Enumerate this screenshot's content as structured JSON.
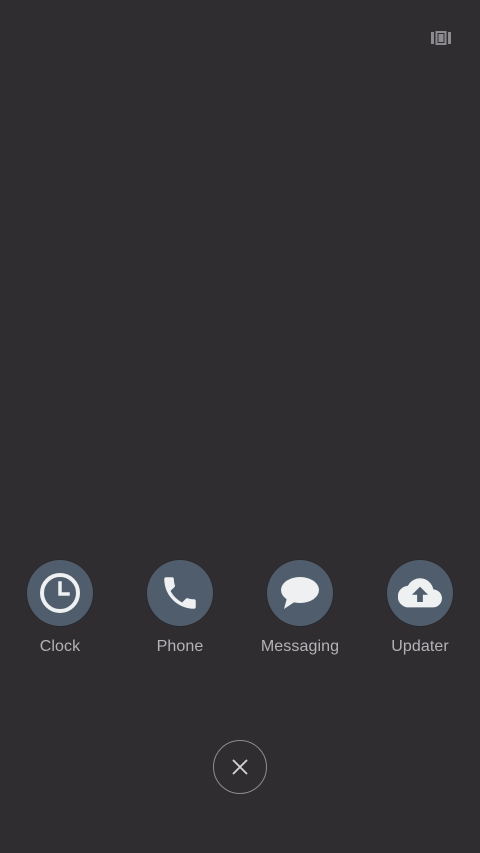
{
  "top_bar": {
    "layout_toggle_icon": "view-carousel-icon"
  },
  "apps": [
    {
      "label": "Clock",
      "icon": "clock-icon"
    },
    {
      "label": "Phone",
      "icon": "phone-icon"
    },
    {
      "label": "Messaging",
      "icon": "chat-bubble-icon"
    },
    {
      "label": "Updater",
      "icon": "cloud-upload-icon"
    }
  ],
  "close_button": {
    "icon": "close-icon"
  },
  "colors": {
    "background": "#2f2d30",
    "icon_circle": "#4f5d6d",
    "label_text": "#b5b3b7",
    "glyph": "#eef0f2"
  }
}
